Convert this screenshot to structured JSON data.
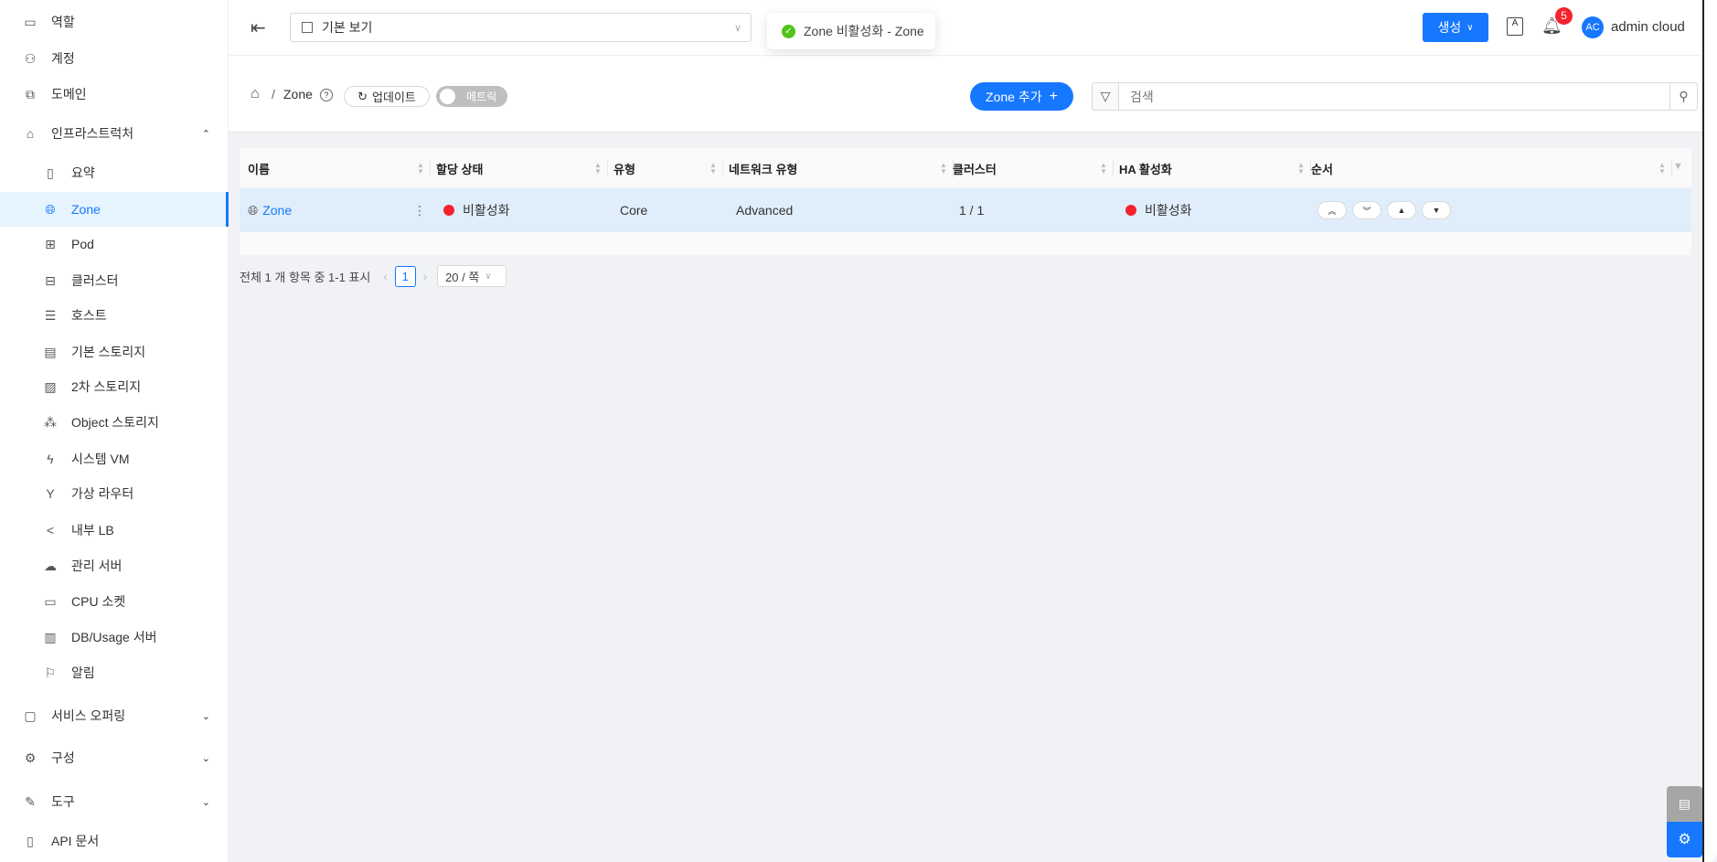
{
  "sidebar": {
    "items": [
      {
        "label": "역할",
        "icon": "id-card-icon"
      },
      {
        "label": "계정",
        "icon": "users-icon"
      },
      {
        "label": "도메인",
        "icon": "domain-icon"
      },
      {
        "label": "인프라스트럭처",
        "icon": "bank-icon"
      },
      {
        "label": "요약",
        "icon": "book-icon"
      },
      {
        "label": "Zone",
        "icon": "globe-icon"
      },
      {
        "label": "Pod",
        "icon": "grid-icon"
      },
      {
        "label": "클러스터",
        "icon": "cluster-icon"
      },
      {
        "label": "호스트",
        "icon": "host-icon"
      },
      {
        "label": "기본 스토리지",
        "icon": "storage-icon"
      },
      {
        "label": "2차 스토리지",
        "icon": "image-icon"
      },
      {
        "label": "Object 스토리지",
        "icon": "object-storage-icon"
      },
      {
        "label": "시스템 VM",
        "icon": "thunder-icon"
      },
      {
        "label": "가상 라우터",
        "icon": "fork-icon"
      },
      {
        "label": "내부 LB",
        "icon": "share-icon"
      },
      {
        "label": "관리 서버",
        "icon": "cloud-server-icon"
      },
      {
        "label": "CPU 소켓",
        "icon": "inbox-icon"
      },
      {
        "label": "DB/Usage 서버",
        "icon": "bar-chart-icon"
      },
      {
        "label": "알림",
        "icon": "flag-icon"
      },
      {
        "label": "서비스 오퍼링",
        "icon": "shopping-icon"
      },
      {
        "label": "구성",
        "icon": "setting-icon"
      },
      {
        "label": "도구",
        "icon": "tool-icon"
      },
      {
        "label": "API 문서",
        "icon": "read-icon"
      }
    ]
  },
  "header": {
    "view_select": "기본 보기",
    "create_label": "생성",
    "notification_count": "5",
    "avatar_initials": "AC",
    "user_name": "admin cloud"
  },
  "toast": {
    "message": "Zone 비활성화 - Zone"
  },
  "toolbar": {
    "breadcrumb": "Zone",
    "refresh_label": "업데이트",
    "metrics_label": "메트릭",
    "add_label": "Zone 추가",
    "search_placeholder": "검색"
  },
  "table": {
    "columns": [
      "이름",
      "할당 상태",
      "유형",
      "네트워크 유형",
      "클러스터",
      "HA 활성화",
      "순서"
    ],
    "rows": [
      {
        "name": "Zone",
        "allocation": "비활성화",
        "type": "Core",
        "network": "Advanced",
        "clusters": "1 / 1",
        "ha": "비활성화"
      }
    ]
  },
  "pagination": {
    "summary": "전체 1 개 항목 중 1-1 표시",
    "current_page": "1",
    "page_size": "20 / 쪽"
  },
  "colors": {
    "accent": "#1677ff",
    "disabled": "#f5222d",
    "success": "#52c41a"
  }
}
